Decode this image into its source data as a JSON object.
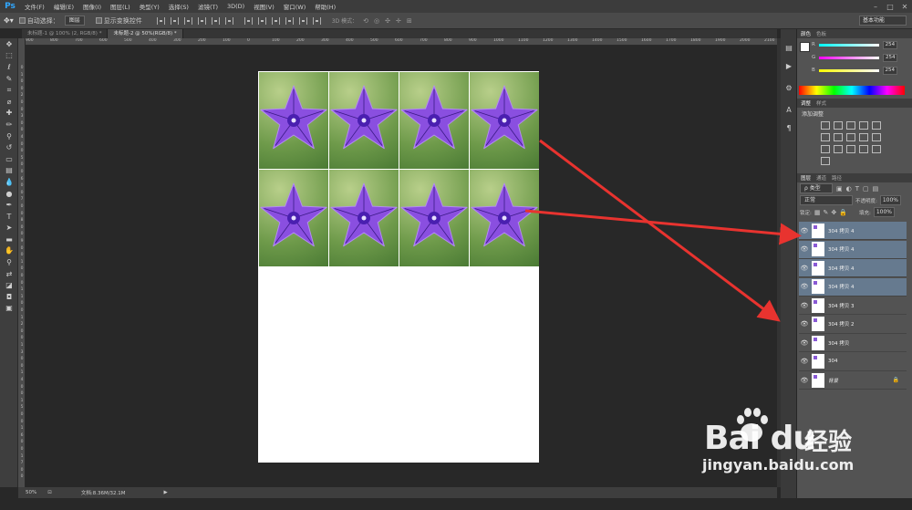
{
  "app": {
    "logo": "Ps",
    "menus": [
      "文件(F)",
      "编辑(E)",
      "图像(I)",
      "图层(L)",
      "类型(Y)",
      "选择(S)",
      "滤镜(T)",
      "3D(D)",
      "视图(V)",
      "窗口(W)",
      "帮助(H)"
    ]
  },
  "options": {
    "auto_select_label": "自动选择：",
    "auto_select_value": "图层",
    "show_transform_label": "显示变换控件",
    "mode_3d_label": "3D 模式：",
    "workspace": "基本功能"
  },
  "tabs": [
    {
      "label": "未标题-1 @ 100% (2, RGB/8) *",
      "active": false
    },
    {
      "label": "未标题-2 @ 50%(RGB/8) *",
      "active": true
    }
  ],
  "ruler_top": [
    "900",
    "800",
    "700",
    "600",
    "500",
    "400",
    "300",
    "200",
    "100",
    "0",
    "100",
    "200",
    "300",
    "400",
    "500",
    "600",
    "700",
    "800",
    "900",
    "1000",
    "1100",
    "1200",
    "1300",
    "1400",
    "1500",
    "1600",
    "1700",
    "1800",
    "1900",
    "2000",
    "2100"
  ],
  "ruler_left": [
    "0",
    "1",
    "0",
    "0",
    "2",
    "0",
    "0",
    "3",
    "0",
    "0",
    "4",
    "0",
    "0",
    "5",
    "0",
    "0",
    "6",
    "0",
    "0",
    "7",
    "0",
    "0",
    "8",
    "0",
    "0",
    "9",
    "0",
    "0",
    "1",
    "0",
    "0",
    "0",
    "1",
    "1",
    "0",
    "0",
    "1",
    "2",
    "0",
    "0",
    "1",
    "3",
    "0",
    "0",
    "1",
    "4",
    "0",
    "0",
    "1",
    "5",
    "0",
    "0",
    "1",
    "6",
    "0",
    "0",
    "1",
    "7",
    "0",
    "0"
  ],
  "status": {
    "zoom": "50%",
    "doc": "文档:8.36M/32.1M"
  },
  "color_panel": {
    "tabs": [
      "颜色",
      "色板"
    ],
    "channels": [
      {
        "label": "R",
        "value": "254"
      },
      {
        "label": "G",
        "value": "254"
      },
      {
        "label": "B",
        "value": "254"
      }
    ]
  },
  "adjust_panel": {
    "tabs": [
      "调整",
      "样式"
    ],
    "title": "添加调整"
  },
  "layers_panel": {
    "tabs": [
      "图层",
      "通道",
      "路径"
    ],
    "kind_filter": "ρ 类型",
    "blend_mode": "正常",
    "opacity_label": "不透明度:",
    "opacity_value": "100%",
    "lock_label": "锁定:",
    "fill_label": "填充:",
    "fill_value": "100%",
    "layers": [
      {
        "name": "304 拷贝 4",
        "selected": true
      },
      {
        "name": "304 拷贝 4",
        "selected": true
      },
      {
        "name": "304 拷贝 4",
        "selected": true
      },
      {
        "name": "304 拷贝 4",
        "selected": true
      },
      {
        "name": "304 拷贝 3",
        "selected": false
      },
      {
        "name": "304 拷贝 2",
        "selected": false
      },
      {
        "name": "304 拷贝",
        "selected": false
      },
      {
        "name": "304",
        "selected": false
      },
      {
        "name": "背景",
        "selected": false
      }
    ]
  },
  "watermark": {
    "brand": "Bai  du",
    "cn": "经验",
    "url": "jingyan.baidu.com"
  },
  "colors": {
    "accent_arrow": "#e8332f",
    "flower": "#8a4fe0",
    "layer_selected": "#667a8f"
  }
}
